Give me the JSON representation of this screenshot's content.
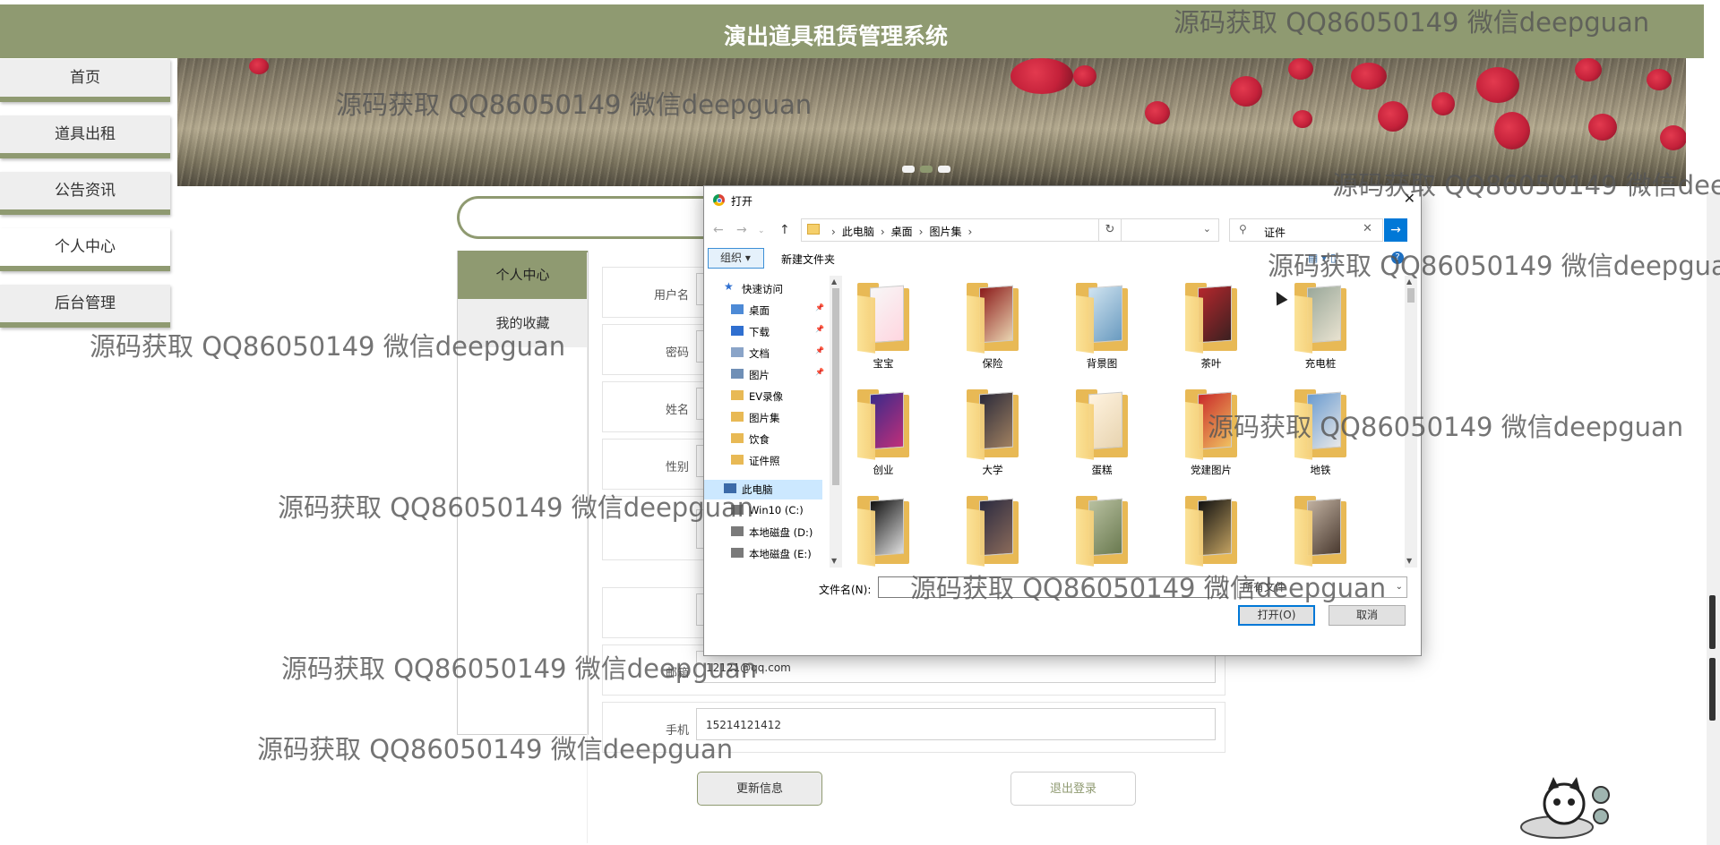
{
  "header": {
    "title": "演出道具租赁管理系统"
  },
  "nav": {
    "items": [
      "首页",
      "道具出租",
      "公告资讯",
      "个人中心",
      "后台管理"
    ],
    "active": "个人中心"
  },
  "panel": {
    "tabs": [
      "个人中心",
      "我的收藏"
    ]
  },
  "form": {
    "fields": [
      {
        "label": "用户名",
        "value": ""
      },
      {
        "label": "密码",
        "value": ""
      },
      {
        "label": "姓名",
        "value": ""
      },
      {
        "label": "性别",
        "value": ""
      },
      {
        "label": "",
        "value": ""
      },
      {
        "label": "",
        "value": ""
      },
      {
        "label": "邮箱",
        "value": "12121@qq.com"
      },
      {
        "label": "手机",
        "value": "15214121412"
      }
    ],
    "update_button": "更新信息",
    "logout_button": "退出登录"
  },
  "dialog": {
    "title": "打开",
    "breadcrumb": [
      "此电脑",
      "桌面",
      "图片集"
    ],
    "search_value": "证件",
    "organize": "组织 ▾",
    "new_folder": "新建文件夹",
    "nav_items": [
      {
        "label": "快速访问",
        "pinned": false
      },
      {
        "label": "桌面",
        "pinned": true
      },
      {
        "label": "下载",
        "pinned": true
      },
      {
        "label": "文档",
        "pinned": true
      },
      {
        "label": "图片",
        "pinned": true
      },
      {
        "label": "EV录像",
        "pinned": false
      },
      {
        "label": "图片集",
        "pinned": false
      },
      {
        "label": "饮食",
        "pinned": false
      },
      {
        "label": "证件照",
        "pinned": false
      },
      {
        "label": "此电脑",
        "pinned": false,
        "selected": true
      },
      {
        "label": "Win10 (C:)",
        "pinned": false
      },
      {
        "label": "本地磁盘 (D:)",
        "pinned": false
      },
      {
        "label": "本地磁盘 (E:)",
        "pinned": false
      }
    ],
    "files": [
      "宝宝",
      "保险",
      "背景图",
      "茶叶",
      "充电桩",
      "创业",
      "大学",
      "蛋糕",
      "党建图片",
      "地铁",
      "",
      "",
      "",
      "",
      ""
    ],
    "filename_label": "文件名(N):",
    "filename_value": "",
    "filetype": "所有文件",
    "open_button": "打开(O)",
    "cancel_button": "取消"
  },
  "watermark_text": "源码获取 QQ86050149 微信deepguan",
  "colors": {
    "accent": "#8f9a71",
    "dialog_blue": "#0078d7"
  }
}
